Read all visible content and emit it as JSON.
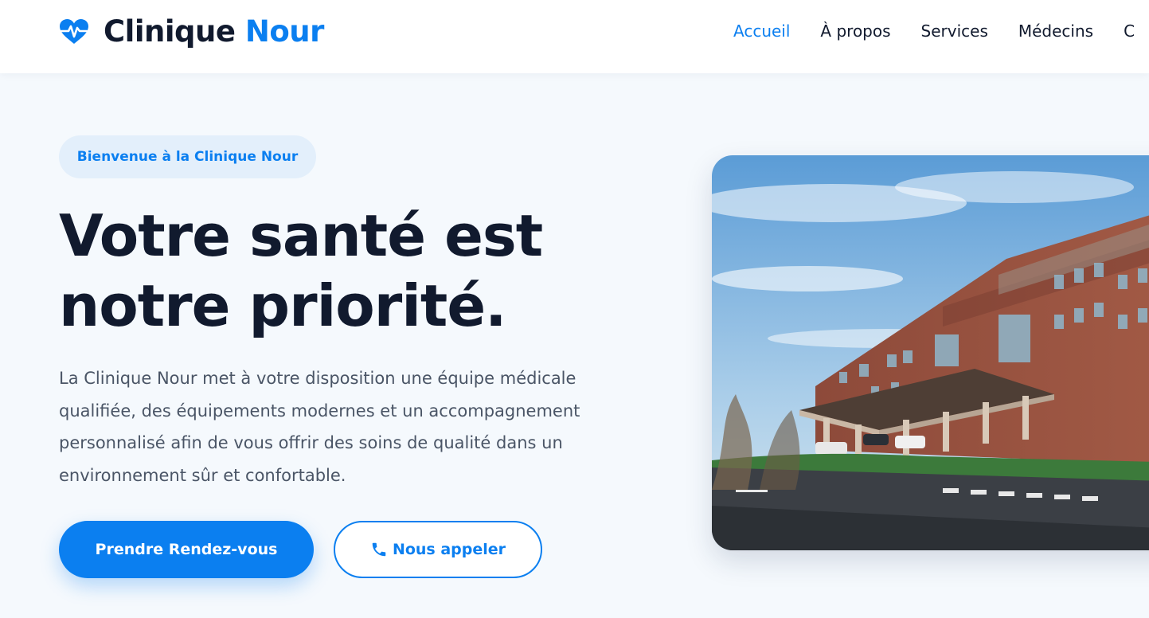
{
  "brand": {
    "name_main": "Clinique",
    "name_accent": "Nour"
  },
  "nav": {
    "items": [
      {
        "label": "Accueil",
        "active": true
      },
      {
        "label": "À propos",
        "active": false
      },
      {
        "label": "Services",
        "active": false
      },
      {
        "label": "Médecins",
        "active": false
      },
      {
        "label": "C",
        "active": false
      }
    ]
  },
  "hero": {
    "badge": "Bienvenue à la Clinique Nour",
    "headline": "Votre santé est notre priorité.",
    "description": "La Clinique Nour met à votre disposition une équipe médicale qualifiée, des équipements modernes et un accompagnement personnalisé afin de vous offrir des soins de qualité dans un environnement sûr et confortable.",
    "primary_button": "Prendre Rendez-vous",
    "secondary_button": "Nous appeler"
  },
  "icons": {
    "brand": "heartbeat-icon",
    "call": "phone-icon"
  },
  "colors": {
    "accent": "#0b7ff0",
    "text_dark": "#111a2e",
    "text_body": "#4a5566",
    "background": "#f5f9fd",
    "badge_bg": "#e3effb"
  }
}
